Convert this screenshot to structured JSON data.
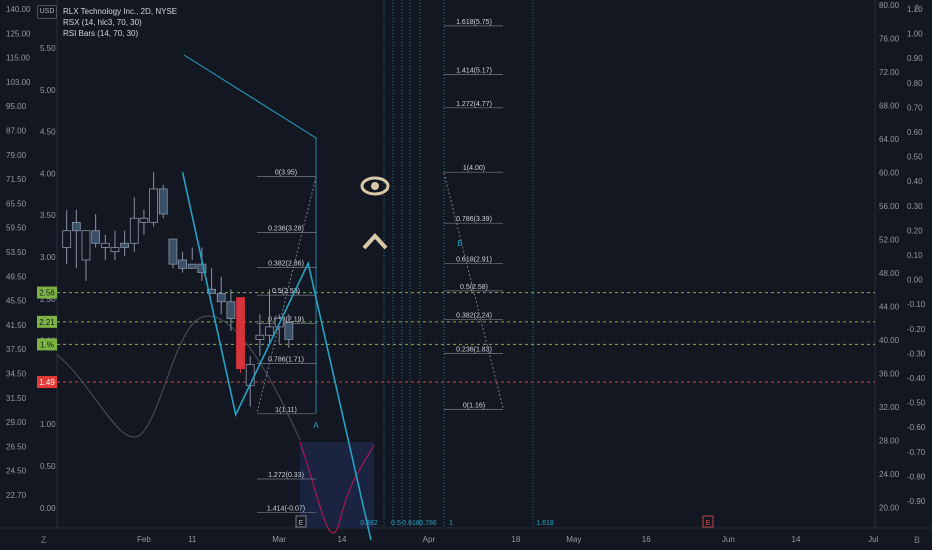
{
  "header": {
    "currency": "USD",
    "symbol_line": "RLX Technology Inc., 2D, NYSE",
    "indicator_1": "RSX (14, hlc3, 70, 30)",
    "indicator_2": "RSI Bars (14, 70, 30)"
  },
  "corners": {
    "bottom_left": "Z",
    "top_right": "A",
    "bottom_right": "B"
  },
  "colors": {
    "background": "#131722",
    "pattern_line": "#26a2c4",
    "fib_line": "#787b86",
    "green_level": "#7cb342",
    "red_level": "#e53935",
    "bear_candle": "#d8323a",
    "candle": "#3a5066",
    "marker": "#d8c8a6"
  },
  "chart_data": {
    "type": "candlestick",
    "title": "RLX Technology Inc., 2D, NYSE",
    "x_ticks": [
      {
        "label": "Feb",
        "d": 18
      },
      {
        "label": "11",
        "d": 28
      },
      {
        "label": "Mar",
        "d": 46
      },
      {
        "label": "14",
        "d": 59
      },
      {
        "label": "Apr",
        "d": 77
      },
      {
        "label": "18",
        "d": 95
      },
      {
        "label": "May",
        "d": 107
      },
      {
        "label": "16",
        "d": 122
      },
      {
        "label": "Jun",
        "d": 139
      },
      {
        "label": "14",
        "d": 153
      },
      {
        "label": "Jul",
        "d": 169
      }
    ],
    "left_log_axis": [
      "140.00",
      "125.00",
      "115.00",
      "103.00",
      "95.00",
      "87.00",
      "79.00",
      "71.50",
      "65.50",
      "59.50",
      "53.50",
      "49.50",
      "45.50",
      "41.50",
      "37.50",
      "34.50",
      "31.50",
      "29.00",
      "26.50",
      "24.50",
      "22.70"
    ],
    "left_linear_axis": [
      "5.50",
      "5.00",
      "4.50",
      "4.00",
      "3.50",
      "3.00",
      "2.50",
      "2.00",
      "1.50",
      "1.00",
      "0.50",
      "0.00"
    ],
    "right_rsx_axis": [
      "80.00",
      "76.00",
      "72.00",
      "68.00",
      "64.00",
      "60.00",
      "56.00",
      "52.00",
      "48.00",
      "44.00",
      "40.00",
      "36.00",
      "32.00",
      "28.00",
      "24.00",
      "20.00"
    ],
    "right_rsi_axis": [
      "1.10",
      "1.00",
      "0.90",
      "0.80",
      "0.70",
      "0.60",
      "0.50",
      "0.40",
      "0.30",
      "0.20",
      "0.10",
      "0.00",
      "-0.10",
      "-0.20",
      "-0.30",
      "-0.40",
      "-0.50",
      "-0.60",
      "-0.70",
      "-0.80",
      "-0.90"
    ],
    "price_levels": [
      {
        "label": "2.56",
        "value": 2.56,
        "kind": "green"
      },
      {
        "label": "2.21",
        "value": 2.21,
        "kind": "green"
      },
      {
        "label": "1.%",
        "value": 1.94,
        "kind": "green"
      },
      {
        "label": "1.49",
        "value": 1.49,
        "kind": "red"
      }
    ],
    "candles": [
      {
        "d": 2,
        "o": 3.1,
        "h": 3.55,
        "l": 2.9,
        "c": 3.3
      },
      {
        "d": 4,
        "o": 3.4,
        "h": 3.55,
        "l": 2.85,
        "c": 3.3
      },
      {
        "d": 6,
        "o": 2.95,
        "h": 3.3,
        "l": 2.7,
        "c": 3.3
      },
      {
        "d": 8,
        "o": 3.3,
        "h": 3.5,
        "l": 3.1,
        "c": 3.15
      },
      {
        "d": 10,
        "o": 3.1,
        "h": 3.25,
        "l": 2.95,
        "c": 3.15
      },
      {
        "d": 12,
        "o": 3.05,
        "h": 3.3,
        "l": 2.95,
        "c": 3.1
      },
      {
        "d": 14,
        "o": 3.15,
        "h": 3.3,
        "l": 3.0,
        "c": 3.1
      },
      {
        "d": 16,
        "o": 3.15,
        "h": 3.7,
        "l": 3.05,
        "c": 3.45
      },
      {
        "d": 18,
        "o": 3.4,
        "h": 3.55,
        "l": 3.25,
        "c": 3.45
      },
      {
        "d": 20,
        "o": 3.4,
        "h": 4.0,
        "l": 3.35,
        "c": 3.8
      },
      {
        "d": 22,
        "o": 3.8,
        "h": 3.85,
        "l": 3.45,
        "c": 3.5
      },
      {
        "d": 24,
        "o": 3.2,
        "h": 3.2,
        "l": 2.85,
        "c": 2.9
      },
      {
        "d": 26,
        "o": 2.95,
        "h": 3.05,
        "l": 2.8,
        "c": 2.85
      },
      {
        "d": 28,
        "o": 2.9,
        "h": 3.1,
        "l": 2.95,
        "c": 2.85
      },
      {
        "d": 30,
        "o": 2.9,
        "h": 3.1,
        "l": 2.7,
        "c": 2.8
      },
      {
        "d": 32,
        "o": 2.6,
        "h": 2.85,
        "l": 2.55,
        "c": 2.55
      },
      {
        "d": 34,
        "o": 2.55,
        "h": 2.75,
        "l": 2.3,
        "c": 2.45
      },
      {
        "d": 36,
        "o": 2.45,
        "h": 2.6,
        "l": 2.1,
        "c": 2.25
      },
      {
        "d": 38,
        "o": 2.5,
        "h": 2.5,
        "l": 1.6,
        "c": 1.65
      },
      {
        "d": 40,
        "o": 1.45,
        "h": 1.8,
        "l": 1.2,
        "c": 1.7
      },
      {
        "d": 42,
        "o": 2.0,
        "h": 2.3,
        "l": 1.8,
        "c": 2.05
      },
      {
        "d": 44,
        "o": 2.05,
        "h": 2.6,
        "l": 1.95,
        "c": 2.15
      },
      {
        "d": 46,
        "o": 2.15,
        "h": 2.3,
        "l": 1.95,
        "c": 2.25
      },
      {
        "d": 48,
        "o": 2.2,
        "h": 2.3,
        "l": 1.9,
        "c": 2.0
      }
    ],
    "pattern_points": [
      {
        "label": "",
        "d": 26,
        "v": 4.0
      },
      {
        "label": "A",
        "d": 37,
        "v": 1.1
      },
      {
        "label": "B",
        "d": 52,
        "v": 2.91
      },
      {
        "label": "",
        "d": 65,
        "v": -0.4
      }
    ],
    "fib_left": [
      {
        "label": "0(3.95)",
        "v": 3.95
      },
      {
        "label": "0.236(3.28)",
        "v": 3.28
      },
      {
        "label": "0.382(2.86)",
        "v": 2.86
      },
      {
        "label": "0.5(2.53)",
        "v": 2.53
      },
      {
        "label": "0.618(2.19)",
        "v": 2.19
      },
      {
        "label": "0.786(1.71)",
        "v": 1.71
      },
      {
        "label": "1(1.11)",
        "v": 1.11
      },
      {
        "label": "1.272(0.33)",
        "v": 0.33
      },
      {
        "label": "1.414(-0.07)",
        "v": -0.07
      }
    ],
    "fib_right": [
      {
        "label": "1.618(5.75)",
        "v": 5.75
      },
      {
        "label": "1.414(5.17)",
        "v": 5.17
      },
      {
        "label": "1.272(4.77)",
        "v": 4.77
      },
      {
        "label": "1(4.00)",
        "v": 4.0
      },
      {
        "label": "0.786(3.39)",
        "v": 3.39
      },
      {
        "label": "0.618(2.91)",
        "v": 2.91
      },
      {
        "label": "0.5(2.58)",
        "v": 2.58
      },
      {
        "label": "0.382(2.24)",
        "v": 2.24
      },
      {
        "label": "0.236(1.83)",
        "v": 1.83
      },
      {
        "label": "0(1.16)",
        "v": 1.16
      }
    ],
    "time_fib_labels": [
      "0.382",
      "0.5",
      "0.618",
      "0.786",
      "1",
      "1.618"
    ],
    "earnings_markers": [
      "E",
      "E"
    ],
    "pattern_labels": [
      "A",
      "B"
    ]
  }
}
